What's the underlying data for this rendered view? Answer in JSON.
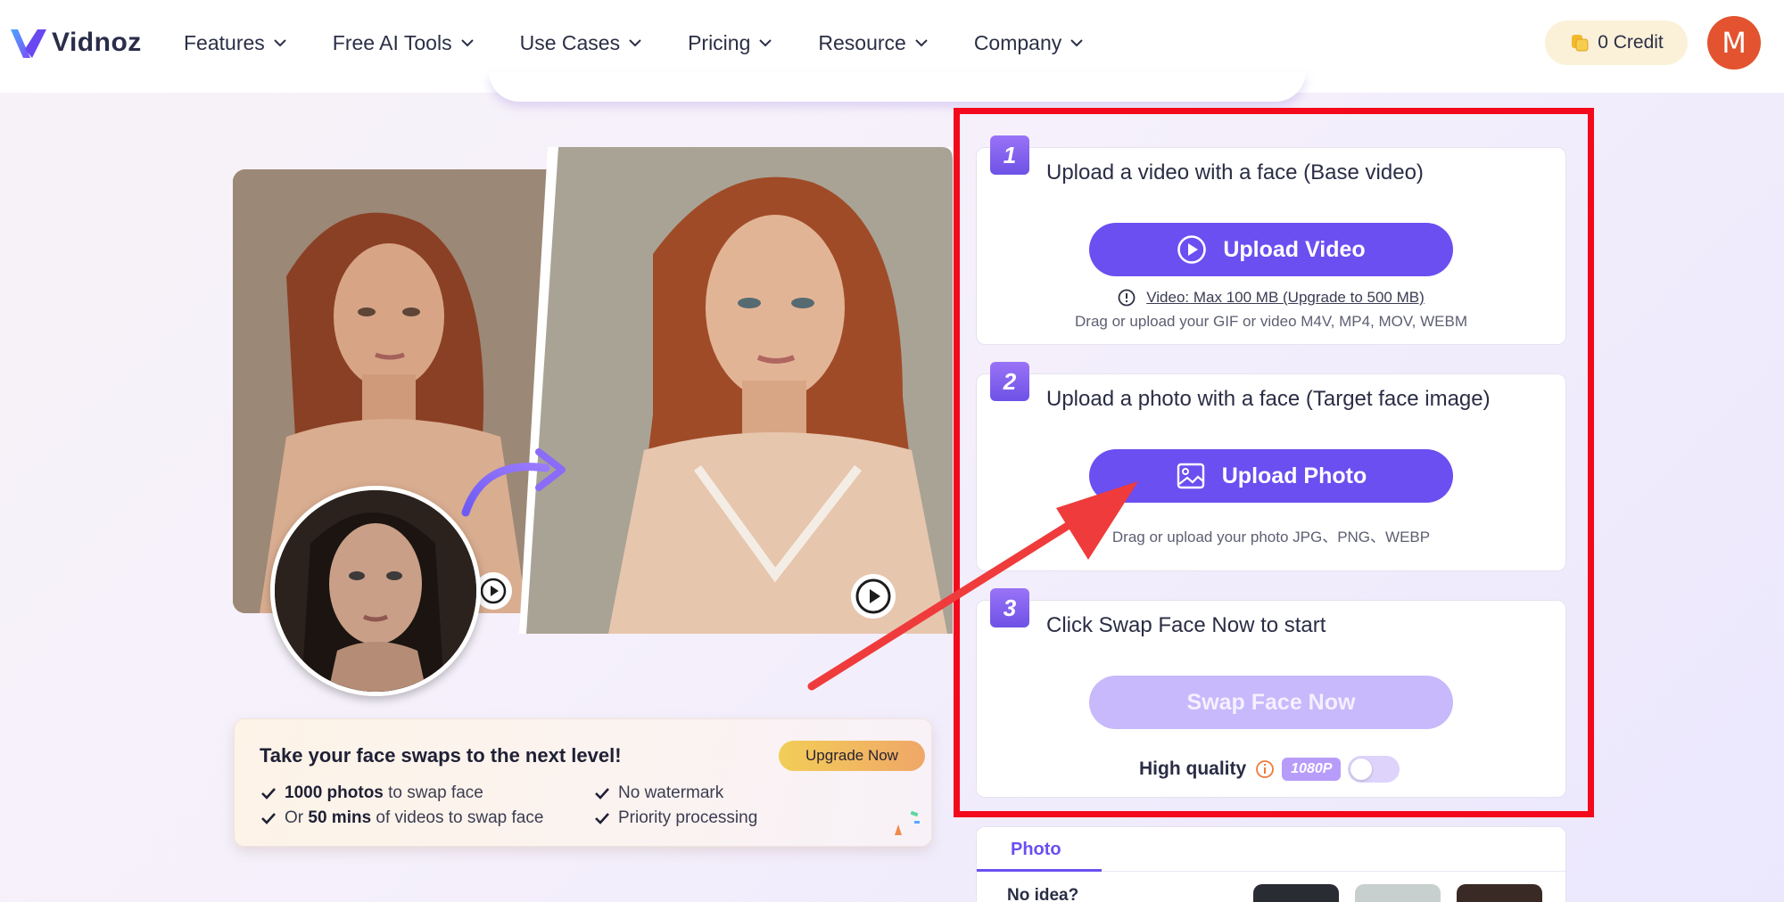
{
  "header": {
    "logo_text": "Vidnoz",
    "nav": [
      {
        "label": "Features"
      },
      {
        "label": "Free AI Tools"
      },
      {
        "label": "Use Cases"
      },
      {
        "label": "Pricing"
      },
      {
        "label": "Resource"
      },
      {
        "label": "Company"
      }
    ],
    "credit_label": "0 Credit",
    "avatar_initial": "M"
  },
  "upgrade": {
    "title": "Take your face swaps to the next level!",
    "button": "Upgrade Now",
    "features": [
      {
        "bold": "1000 photos",
        "rest": " to swap face",
        "prefix": ""
      },
      {
        "bold": "50 mins",
        "rest": " of videos to swap face",
        "prefix": "Or "
      },
      {
        "bold": "",
        "rest": "No watermark",
        "prefix": ""
      },
      {
        "bold": "",
        "rest": "Priority processing",
        "prefix": ""
      }
    ]
  },
  "steps": [
    {
      "number": "1",
      "title": "Upload a video with a face (Base video)",
      "button": "Upload Video",
      "limit": "Video: Max 100 MB (Upgrade to 500 MB)",
      "note": "Drag or upload your GIF or video M4V, MP4, MOV, WEBM"
    },
    {
      "number": "2",
      "title": "Upload a photo with a face (Target face image)",
      "button": "Upload Photo",
      "note": "Drag or upload your photo JPG、PNG、WEBP"
    },
    {
      "number": "3",
      "title": "Click Swap Face Now to start",
      "button": "Swap Face Now",
      "hq_label": "High quality",
      "hq_badge": "1080P"
    }
  ],
  "photo_panel": {
    "tab": "Photo",
    "prompt": "No idea?"
  },
  "colors": {
    "accent": "#6b4ff0",
    "highlight": "#f3091b",
    "disabled": "#c7b9fb"
  }
}
